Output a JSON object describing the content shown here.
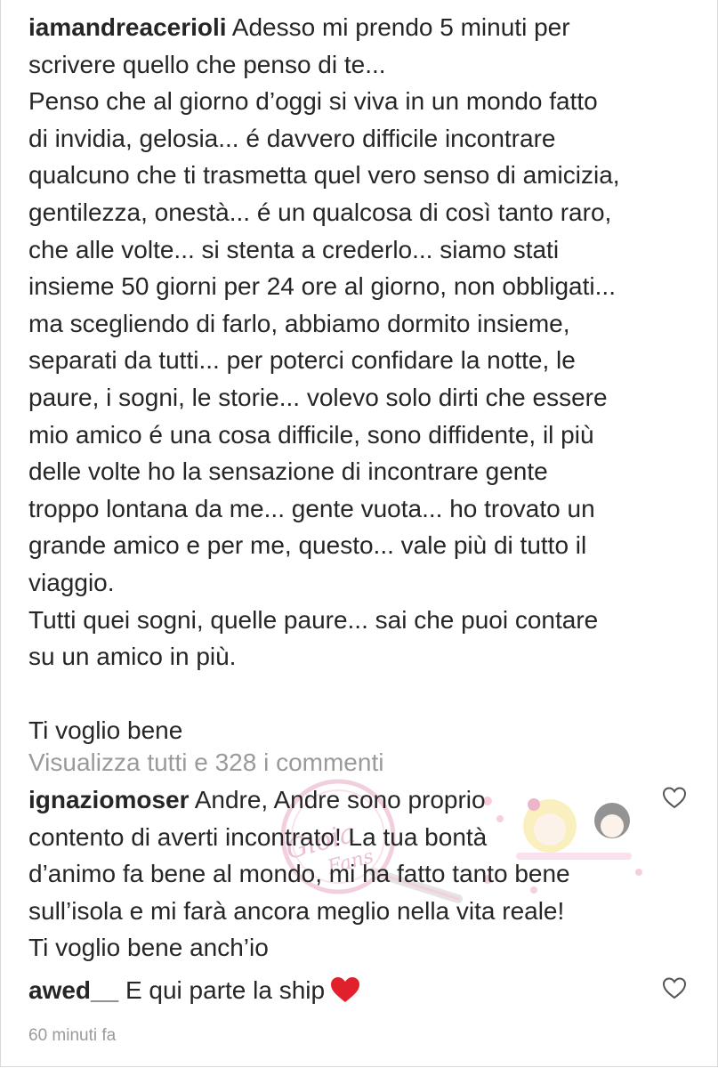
{
  "post": {
    "author": "iamandreacerioli",
    "caption_lines": [
      "Adesso mi prendo 5 minuti per",
      "scrivere quello che penso di te...",
      "Penso che al giorno d’oggi si viva in un mondo fatto",
      "di invidia, gelosia... é davvero difficile incontrare",
      "qualcuno che ti trasmetta quel vero senso di amicizia,",
      "gentilezza, onestà... é un qualcosa di così tanto raro,",
      "che alle volte... si stenta a crederlo... siamo stati",
      "insieme 50 giorni per 24 ore al giorno, non obbligati...",
      "ma scegliendo di farlo, abbiamo dormito insieme,",
      "separati da tutti... per poterci confidare la notte, le",
      "paure, i sogni, le storie... volevo solo dirti che essere",
      "mio amico é una cosa difficile, sono diffidente, il più",
      "delle volte ho la sensazione di incontrare gente",
      "troppo lontana da me... gente vuota... ho trovato un",
      "grande amico e per me, questo... vale più di tutto il",
      "viaggio.",
      "Tutti quei sogni, quelle paure... sai che puoi contare",
      "su un amico in più."
    ],
    "closing": "Ti voglio bene"
  },
  "view_all_comments": "Visualizza tutti e 328 i commenti",
  "comments": [
    {
      "author": "ignaziomoser",
      "lines": [
        "Andre, Andre sono proprio",
        "contento di averti incontrato! La tua bontà",
        "d’animo fa bene al mondo, mi ha fatto tanto bene",
        "sull’isola e mi farà ancora meglio nella vita reale!",
        "Ti voglio bene anch’io"
      ]
    },
    {
      "author": "awed__",
      "text": "E qui parte la ship"
    }
  ],
  "timestamp": "60 minuti fa",
  "watermark_text": "Gioia Fans",
  "colors": {
    "text": "#262626",
    "muted": "#9a9a9a",
    "heart_red": "#e0202b"
  },
  "icons": {
    "like": "heart-outline-icon",
    "emoji": "red-heart-emoji"
  }
}
